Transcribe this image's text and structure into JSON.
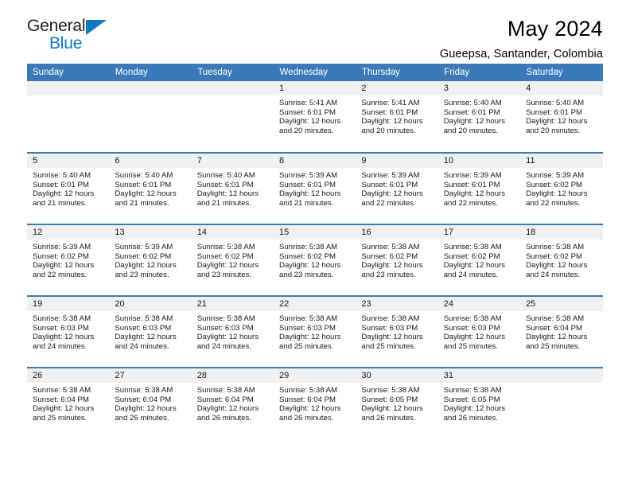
{
  "brand": {
    "name_primary": "General",
    "name_secondary": "Blue"
  },
  "header": {
    "title": "May 2024",
    "subtitle": "Gueepsa, Santander, Colombia"
  },
  "colors": {
    "header_blue": "#3b79b9",
    "logo_blue": "#1077c3",
    "daynum_band": "#f0f0f0"
  },
  "calendar": {
    "weekday_headers": [
      "Sunday",
      "Monday",
      "Tuesday",
      "Wednesday",
      "Thursday",
      "Friday",
      "Saturday"
    ],
    "weeks": [
      [
        {
          "day": "",
          "info": ""
        },
        {
          "day": "",
          "info": ""
        },
        {
          "day": "",
          "info": ""
        },
        {
          "day": "1",
          "info": "Sunrise: 5:41 AM\nSunset: 6:01 PM\nDaylight: 12 hours\nand 20 minutes."
        },
        {
          "day": "2",
          "info": "Sunrise: 5:41 AM\nSunset: 6:01 PM\nDaylight: 12 hours\nand 20 minutes."
        },
        {
          "day": "3",
          "info": "Sunrise: 5:40 AM\nSunset: 6:01 PM\nDaylight: 12 hours\nand 20 minutes."
        },
        {
          "day": "4",
          "info": "Sunrise: 5:40 AM\nSunset: 6:01 PM\nDaylight: 12 hours\nand 20 minutes."
        }
      ],
      [
        {
          "day": "5",
          "info": "Sunrise: 5:40 AM\nSunset: 6:01 PM\nDaylight: 12 hours\nand 21 minutes."
        },
        {
          "day": "6",
          "info": "Sunrise: 5:40 AM\nSunset: 6:01 PM\nDaylight: 12 hours\nand 21 minutes."
        },
        {
          "day": "7",
          "info": "Sunrise: 5:40 AM\nSunset: 6:01 PM\nDaylight: 12 hours\nand 21 minutes."
        },
        {
          "day": "8",
          "info": "Sunrise: 5:39 AM\nSunset: 6:01 PM\nDaylight: 12 hours\nand 21 minutes."
        },
        {
          "day": "9",
          "info": "Sunrise: 5:39 AM\nSunset: 6:01 PM\nDaylight: 12 hours\nand 22 minutes."
        },
        {
          "day": "10",
          "info": "Sunrise: 5:39 AM\nSunset: 6:01 PM\nDaylight: 12 hours\nand 22 minutes."
        },
        {
          "day": "11",
          "info": "Sunrise: 5:39 AM\nSunset: 6:02 PM\nDaylight: 12 hours\nand 22 minutes."
        }
      ],
      [
        {
          "day": "12",
          "info": "Sunrise: 5:39 AM\nSunset: 6:02 PM\nDaylight: 12 hours\nand 22 minutes."
        },
        {
          "day": "13",
          "info": "Sunrise: 5:39 AM\nSunset: 6:02 PM\nDaylight: 12 hours\nand 23 minutes."
        },
        {
          "day": "14",
          "info": "Sunrise: 5:38 AM\nSunset: 6:02 PM\nDaylight: 12 hours\nand 23 minutes."
        },
        {
          "day": "15",
          "info": "Sunrise: 5:38 AM\nSunset: 6:02 PM\nDaylight: 12 hours\nand 23 minutes."
        },
        {
          "day": "16",
          "info": "Sunrise: 5:38 AM\nSunset: 6:02 PM\nDaylight: 12 hours\nand 23 minutes."
        },
        {
          "day": "17",
          "info": "Sunrise: 5:38 AM\nSunset: 6:02 PM\nDaylight: 12 hours\nand 24 minutes."
        },
        {
          "day": "18",
          "info": "Sunrise: 5:38 AM\nSunset: 6:02 PM\nDaylight: 12 hours\nand 24 minutes."
        }
      ],
      [
        {
          "day": "19",
          "info": "Sunrise: 5:38 AM\nSunset: 6:03 PM\nDaylight: 12 hours\nand 24 minutes."
        },
        {
          "day": "20",
          "info": "Sunrise: 5:38 AM\nSunset: 6:03 PM\nDaylight: 12 hours\nand 24 minutes."
        },
        {
          "day": "21",
          "info": "Sunrise: 5:38 AM\nSunset: 6:03 PM\nDaylight: 12 hours\nand 24 minutes."
        },
        {
          "day": "22",
          "info": "Sunrise: 5:38 AM\nSunset: 6:03 PM\nDaylight: 12 hours\nand 25 minutes."
        },
        {
          "day": "23",
          "info": "Sunrise: 5:38 AM\nSunset: 6:03 PM\nDaylight: 12 hours\nand 25 minutes."
        },
        {
          "day": "24",
          "info": "Sunrise: 5:38 AM\nSunset: 6:03 PM\nDaylight: 12 hours\nand 25 minutes."
        },
        {
          "day": "25",
          "info": "Sunrise: 5:38 AM\nSunset: 6:04 PM\nDaylight: 12 hours\nand 25 minutes."
        }
      ],
      [
        {
          "day": "26",
          "info": "Sunrise: 5:38 AM\nSunset: 6:04 PM\nDaylight: 12 hours\nand 25 minutes."
        },
        {
          "day": "27",
          "info": "Sunrise: 5:38 AM\nSunset: 6:04 PM\nDaylight: 12 hours\nand 26 minutes."
        },
        {
          "day": "28",
          "info": "Sunrise: 5:38 AM\nSunset: 6:04 PM\nDaylight: 12 hours\nand 26 minutes."
        },
        {
          "day": "29",
          "info": "Sunrise: 5:38 AM\nSunset: 6:04 PM\nDaylight: 12 hours\nand 26 minutes."
        },
        {
          "day": "30",
          "info": "Sunrise: 5:38 AM\nSunset: 6:05 PM\nDaylight: 12 hours\nand 26 minutes."
        },
        {
          "day": "31",
          "info": "Sunrise: 5:38 AM\nSunset: 6:05 PM\nDaylight: 12 hours\nand 26 minutes."
        },
        {
          "day": "",
          "info": ""
        }
      ]
    ]
  }
}
